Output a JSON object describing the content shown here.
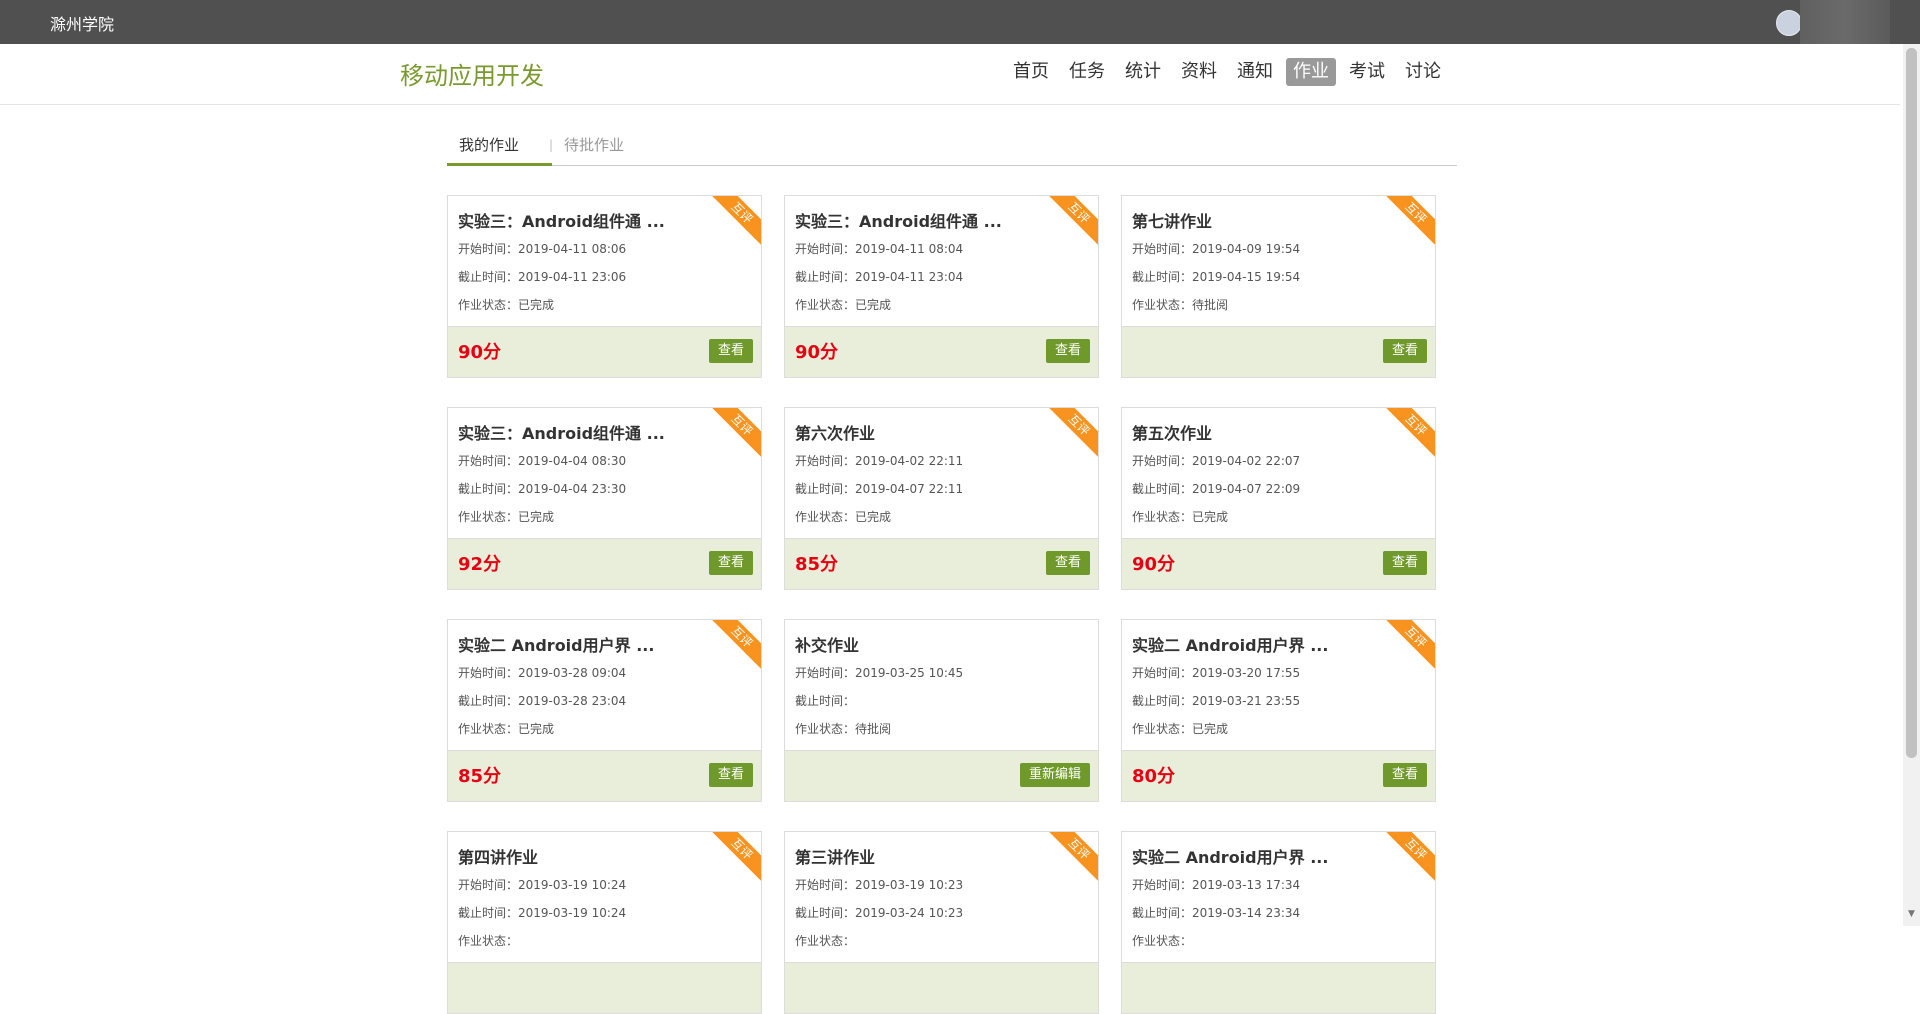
{
  "topbar": {
    "school": "滁州学院"
  },
  "header": {
    "course_title": "移动应用开发",
    "nav": [
      "首页",
      "任务",
      "统计",
      "资料",
      "通知",
      "作业",
      "考试",
      "讨论"
    ],
    "active_nav": "作业"
  },
  "subtabs": {
    "mine": "我的作业",
    "pending": "待批作业",
    "separator": "|"
  },
  "labels": {
    "start": "开始时间：",
    "end": "截止时间：",
    "status": "作业状态："
  },
  "ribbon_label": "互评",
  "cards": [
    {
      "title": "实验三：Android组件通 ...",
      "start": "2019-04-11 08:06",
      "end": "2019-04-11 23:06",
      "status": "已完成",
      "score": "90分",
      "button": "查看",
      "ribbon": true
    },
    {
      "title": "实验三：Android组件通 ...",
      "start": "2019-04-11 08:04",
      "end": "2019-04-11 23:04",
      "status": "已完成",
      "score": "90分",
      "button": "查看",
      "ribbon": true
    },
    {
      "title": "第七讲作业",
      "start": "2019-04-09 19:54",
      "end": "2019-04-15 19:54",
      "status": "待批阅",
      "score": "",
      "button": "查看",
      "ribbon": true
    },
    {
      "title": "实验三：Android组件通 ...",
      "start": "2019-04-04 08:30",
      "end": "2019-04-04 23:30",
      "status": "已完成",
      "score": "92分",
      "button": "查看",
      "ribbon": true
    },
    {
      "title": "第六次作业",
      "start": "2019-04-02 22:11",
      "end": "2019-04-07 22:11",
      "status": "已完成",
      "score": "85分",
      "button": "查看",
      "ribbon": true
    },
    {
      "title": "第五次作业",
      "start": "2019-04-02 22:07",
      "end": "2019-04-07 22:09",
      "status": "已完成",
      "score": "90分",
      "button": "查看",
      "ribbon": true
    },
    {
      "title": "实验二 Android用户界 ...",
      "start": "2019-03-28 09:04",
      "end": "2019-03-28 23:04",
      "status": "已完成",
      "score": "85分",
      "button": "查看",
      "ribbon": true
    },
    {
      "title": "补交作业",
      "start": "2019-03-25 10:45",
      "end": "",
      "status": "待批阅",
      "score": "",
      "button": "重新编辑",
      "ribbon": false
    },
    {
      "title": "实验二 Android用户界 ...",
      "start": "2019-03-20 17:55",
      "end": "2019-03-21 23:55",
      "status": "已完成",
      "score": "80分",
      "button": "查看",
      "ribbon": true
    },
    {
      "title": "第四讲作业",
      "start": "2019-03-19 10:24",
      "end": "2019-03-19 10:24",
      "status": "",
      "score": "",
      "button": "",
      "ribbon": true
    },
    {
      "title": "第三讲作业",
      "start": "2019-03-19 10:23",
      "end": "2019-03-24 10:23",
      "status": "",
      "score": "",
      "button": "",
      "ribbon": true
    },
    {
      "title": "实验二 Android用户界 ...",
      "start": "2019-03-13 17:34",
      "end": "2019-03-14 23:34",
      "status": "",
      "score": "",
      "button": "",
      "ribbon": true
    }
  ]
}
